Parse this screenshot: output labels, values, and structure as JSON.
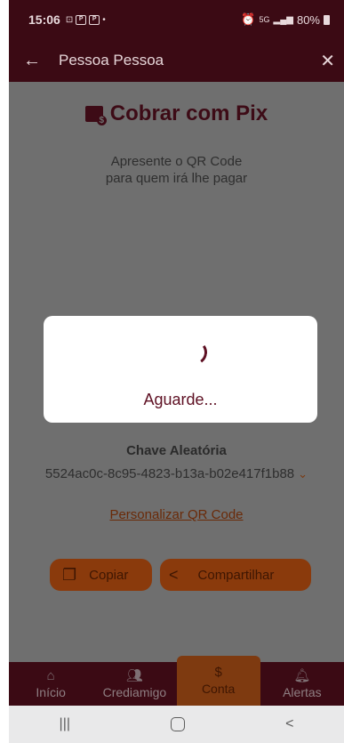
{
  "status": {
    "time": "15:06",
    "battery": "80%",
    "network": "5G"
  },
  "header": {
    "title": "Pessoa Pessoa"
  },
  "pix": {
    "title": "Cobrar com Pix",
    "subtitle_line1": "Apresente o QR Code",
    "subtitle_line2": "para quem irá lhe pagar",
    "key_label": "Chave Aleatória",
    "key_value": "5524ac0c-8c95-4823-b13a-b02e417f1b88",
    "customize_link": "Personalizar QR Code",
    "copy_button": "Copiar",
    "share_button": "Compartilhar"
  },
  "dialog": {
    "message": "Aguarde..."
  },
  "bottom_nav": {
    "items": [
      {
        "label": "Início",
        "icon": "home-icon"
      },
      {
        "label": "Crediamigo",
        "icon": "people-icon"
      },
      {
        "label": "Conta",
        "icon": "dollar-icon"
      },
      {
        "label": "Alertas",
        "icon": "bell-icon"
      }
    ],
    "active_index": 2
  },
  "colors": {
    "brand_dark": "#3b0a14",
    "accent": "#5e1023",
    "orange": "#8a3a0c",
    "overlay": "#6f6f6f"
  }
}
